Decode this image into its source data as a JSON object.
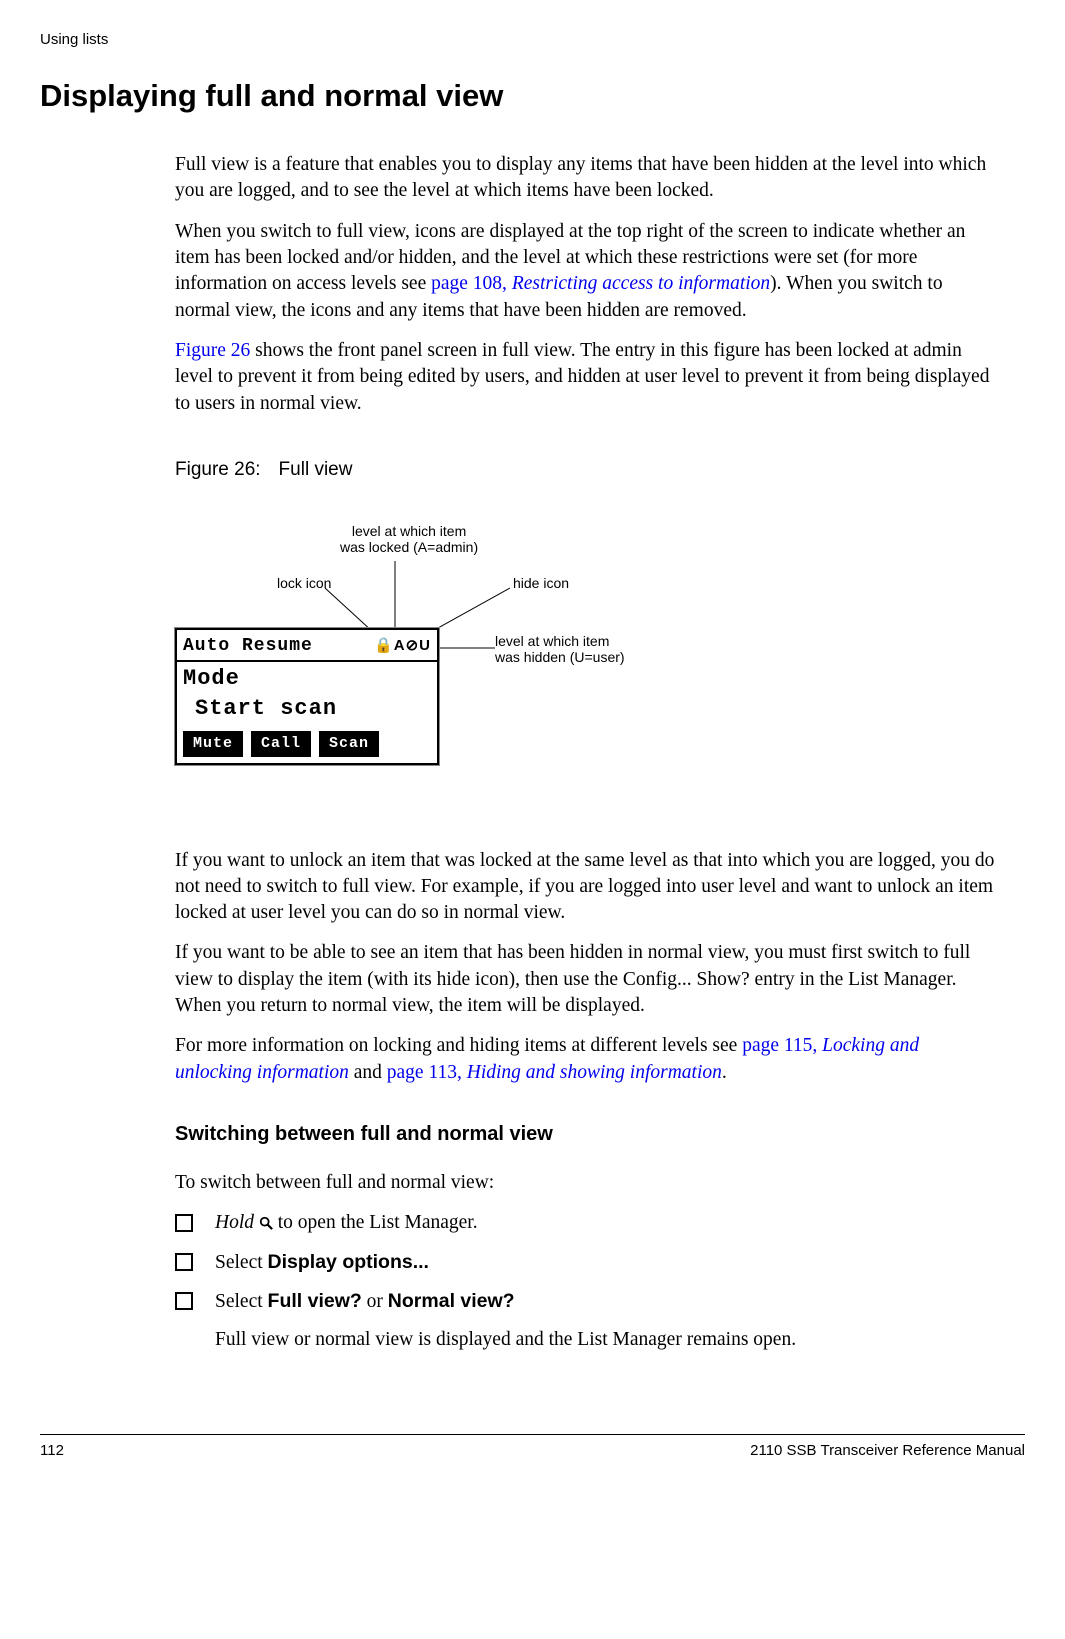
{
  "header": {
    "section": "Using lists"
  },
  "title": "Displaying full and normal view",
  "paragraphs": {
    "p1": "Full view is a feature that enables you to display any items that have been hidden at the level into which you are logged, and to see the level at which items have been locked.",
    "p2_a": "When you switch to full view, icons are displayed at the top right of the screen to indicate whether an item has been locked and/or hidden, and the level at which these restrictions were set (for more information on access levels see ",
    "p2_link_text": "page 108, Restricting access to information",
    "p2_b": "). When you switch to normal view, the icons and any items that have been hidden are removed.",
    "p3_link": "Figure 26",
    "p3_rest": " shows the front panel screen in full view. The entry in this figure has been locked at admin level to prevent it from being edited by users, and hidden at user level to prevent it from being displayed to users in normal view.",
    "p4": "If you want to unlock an item that was locked at the same level as that into which you are logged, you do not need to switch to full view. For example, if you are logged into user level and want to unlock an item locked at user level you can do so in normal view.",
    "p5": "If you want to be able to see an item that has been hidden in normal view, you must first switch to full view to display the item (with its hide icon), then use the Config... Show? entry in the List Manager. When you return to normal view, the item will be displayed.",
    "p6_a": "For more information on locking and hiding items at different levels see ",
    "p6_link1": "page 115, Locking and unlocking information",
    "p6_mid": " and ",
    "p6_link2": "page 113, Hiding and showing information",
    "p6_end": "."
  },
  "figure": {
    "label_num": "Figure 26:",
    "label_title": "Full view",
    "annotations": {
      "lock_icon": "lock icon",
      "level_locked_l1": "level at which item",
      "level_locked_l2": "was locked (A=admin)",
      "hide_icon": "hide icon",
      "level_hidden_l1": "level at which item",
      "level_hidden_l2": "was hidden (U=user)"
    },
    "lcd": {
      "row1_title": "Auto Resume",
      "row1_icons": "🔒A👁U",
      "row2": "Mode",
      "row3": "Start scan",
      "softkeys": [
        "Mute",
        "Call",
        "Scan"
      ]
    }
  },
  "subsection": {
    "title": "Switching between full and normal view",
    "intro": "To switch between full and normal view:",
    "steps": {
      "s1_a": "Hold",
      "s1_b": " to open the List Manager.",
      "s2_a": "Select ",
      "s2_bold": "Display options...",
      "s3_a": "Select ",
      "s3_bold1": "Full view?",
      "s3_or": " or ",
      "s3_bold2": "Normal view?"
    },
    "after": "Full view or normal view is displayed and the List Manager remains open."
  },
  "footer": {
    "page": "112",
    "doc": "2110 SSB Transceiver Reference Manual"
  }
}
